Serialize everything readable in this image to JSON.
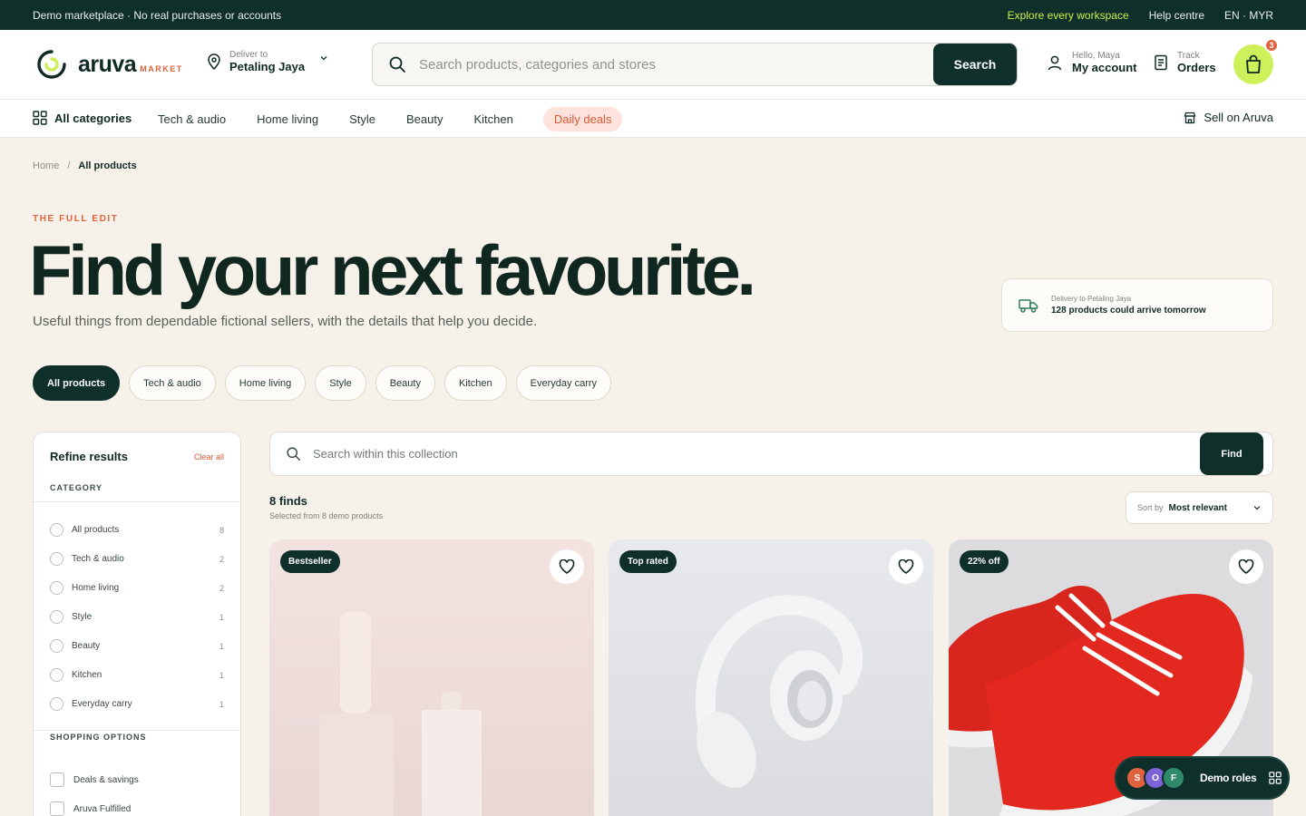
{
  "topbar": {
    "notice": "Demo marketplace · No real purchases or accounts",
    "explore": "Explore every workspace",
    "help": "Help centre",
    "locale": "EN · MYR"
  },
  "header": {
    "logo_word": "aruva",
    "logo_sub": "MARKET",
    "deliver_label": "Deliver to",
    "deliver_value": "Petaling Jaya",
    "search_placeholder": "Search products, categories and stores",
    "search_button": "Search",
    "account_greeting": "Hello, Maya",
    "account_label": "My account",
    "orders_label": "Track",
    "orders_value": "Orders",
    "cart_count": "3"
  },
  "nav": {
    "all_categories": "All categories",
    "items": [
      "Tech & audio",
      "Home living",
      "Style",
      "Beauty",
      "Kitchen"
    ],
    "deals": "Daily deals",
    "sell": "Sell on Aruva"
  },
  "breadcrumb": {
    "home": "Home",
    "sep": "/",
    "current": "All products"
  },
  "hero": {
    "eyebrow": "THE FULL EDIT",
    "title": "Find your next favourite.",
    "subtitle": "Useful things from dependable fictional sellers, with the details that help you decide."
  },
  "eta": {
    "label": "Delivery to Petaling Jaya",
    "value": "128 products could arrive tomorrow"
  },
  "chips": [
    "All products",
    "Tech & audio",
    "Home living",
    "Style",
    "Beauty",
    "Kitchen",
    "Everyday carry"
  ],
  "sidebar": {
    "title": "Refine results",
    "clear": "Clear all",
    "category_heading": "CATEGORY",
    "categories": [
      {
        "label": "All products",
        "count": "8"
      },
      {
        "label": "Tech & audio",
        "count": "2"
      },
      {
        "label": "Home living",
        "count": "2"
      },
      {
        "label": "Style",
        "count": "1"
      },
      {
        "label": "Beauty",
        "count": "1"
      },
      {
        "label": "Kitchen",
        "count": "1"
      },
      {
        "label": "Everyday carry",
        "count": "1"
      }
    ],
    "shopping_heading": "SHOPPING OPTIONS",
    "options": [
      "Deals & savings",
      "Aruva Fulfilled"
    ]
  },
  "collection": {
    "search_placeholder": "Search within this collection",
    "find_button": "Find",
    "count": "8 finds",
    "count_sub": "Selected from 8 demo products",
    "sort_label": "Sort by",
    "sort_value": "Most relevant"
  },
  "cards": [
    {
      "tag": "Bestseller"
    },
    {
      "tag": "Top rated"
    },
    {
      "tag": "22% off"
    }
  ],
  "roles": {
    "avatars": [
      "S",
      "O",
      "F"
    ],
    "label": "Demo roles"
  },
  "colors": {
    "brand_dark": "#0e2f2a",
    "accent_lime": "#cdf05b",
    "accent_orange": "#e0623e",
    "background": "#f6f2ea"
  }
}
